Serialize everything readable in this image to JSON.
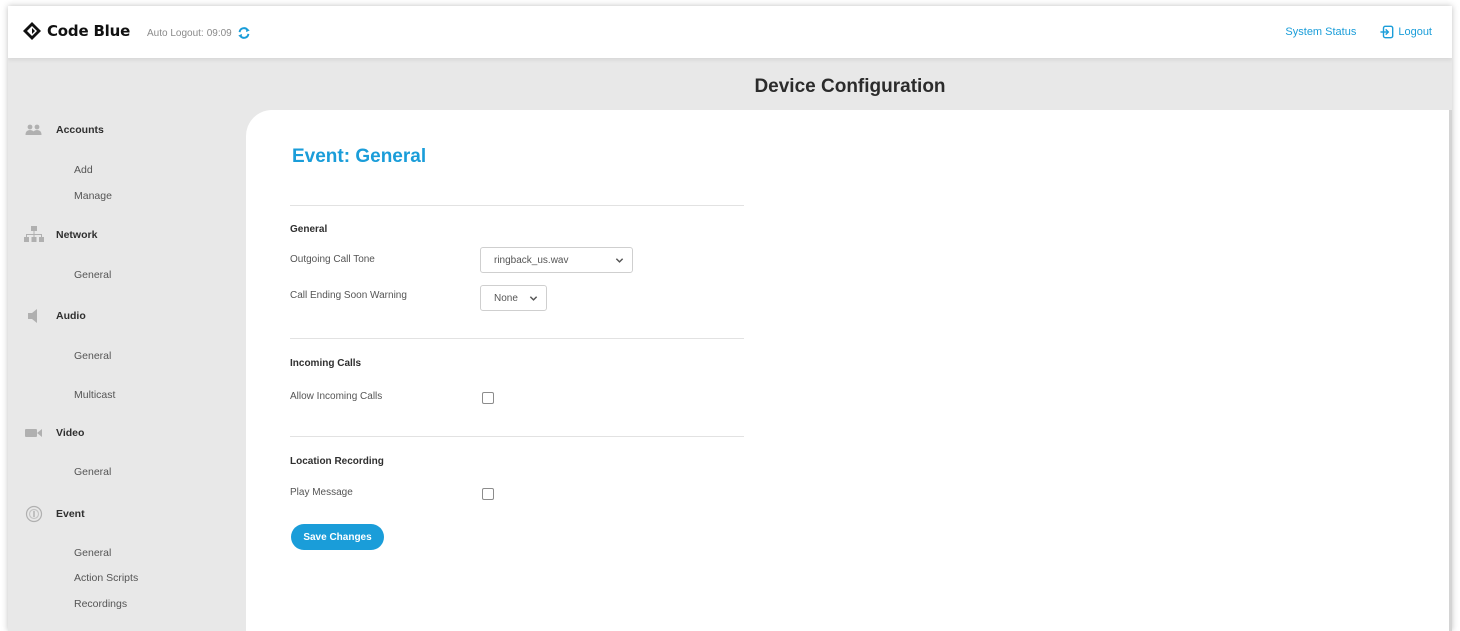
{
  "header": {
    "brand": "Code Blue",
    "auto_logout_label": "Auto Logout:",
    "auto_logout_time": "09:09",
    "system_status": "System Status",
    "logout": "Logout"
  },
  "page_title": "Device Configuration",
  "sidebar": {
    "accounts": {
      "label": "Accounts",
      "items": [
        "Add",
        "Manage"
      ]
    },
    "network": {
      "label": "Network",
      "items": [
        "General"
      ]
    },
    "audio": {
      "label": "Audio",
      "items": [
        "General",
        "Multicast"
      ]
    },
    "video": {
      "label": "Video",
      "items": [
        "General"
      ]
    },
    "event": {
      "label": "Event",
      "items": [
        "General",
        "Action Scripts",
        "Recordings"
      ]
    }
  },
  "main": {
    "title": "Event: General",
    "general": {
      "heading": "General",
      "outgoing_call_tone_label": "Outgoing Call Tone",
      "outgoing_call_tone_value": "ringback_us.wav",
      "call_ending_label": "Call Ending Soon Warning",
      "call_ending_value": "None"
    },
    "incoming": {
      "heading": "Incoming Calls",
      "allow_label": "Allow Incoming Calls",
      "allow_checked": false
    },
    "location": {
      "heading": "Location Recording",
      "play_label": "Play Message",
      "play_checked": false
    },
    "save_label": "Save Changes"
  },
  "colors": {
    "accent": "#1a9dd9",
    "band": "#e8e8e8",
    "text": "#333333"
  }
}
